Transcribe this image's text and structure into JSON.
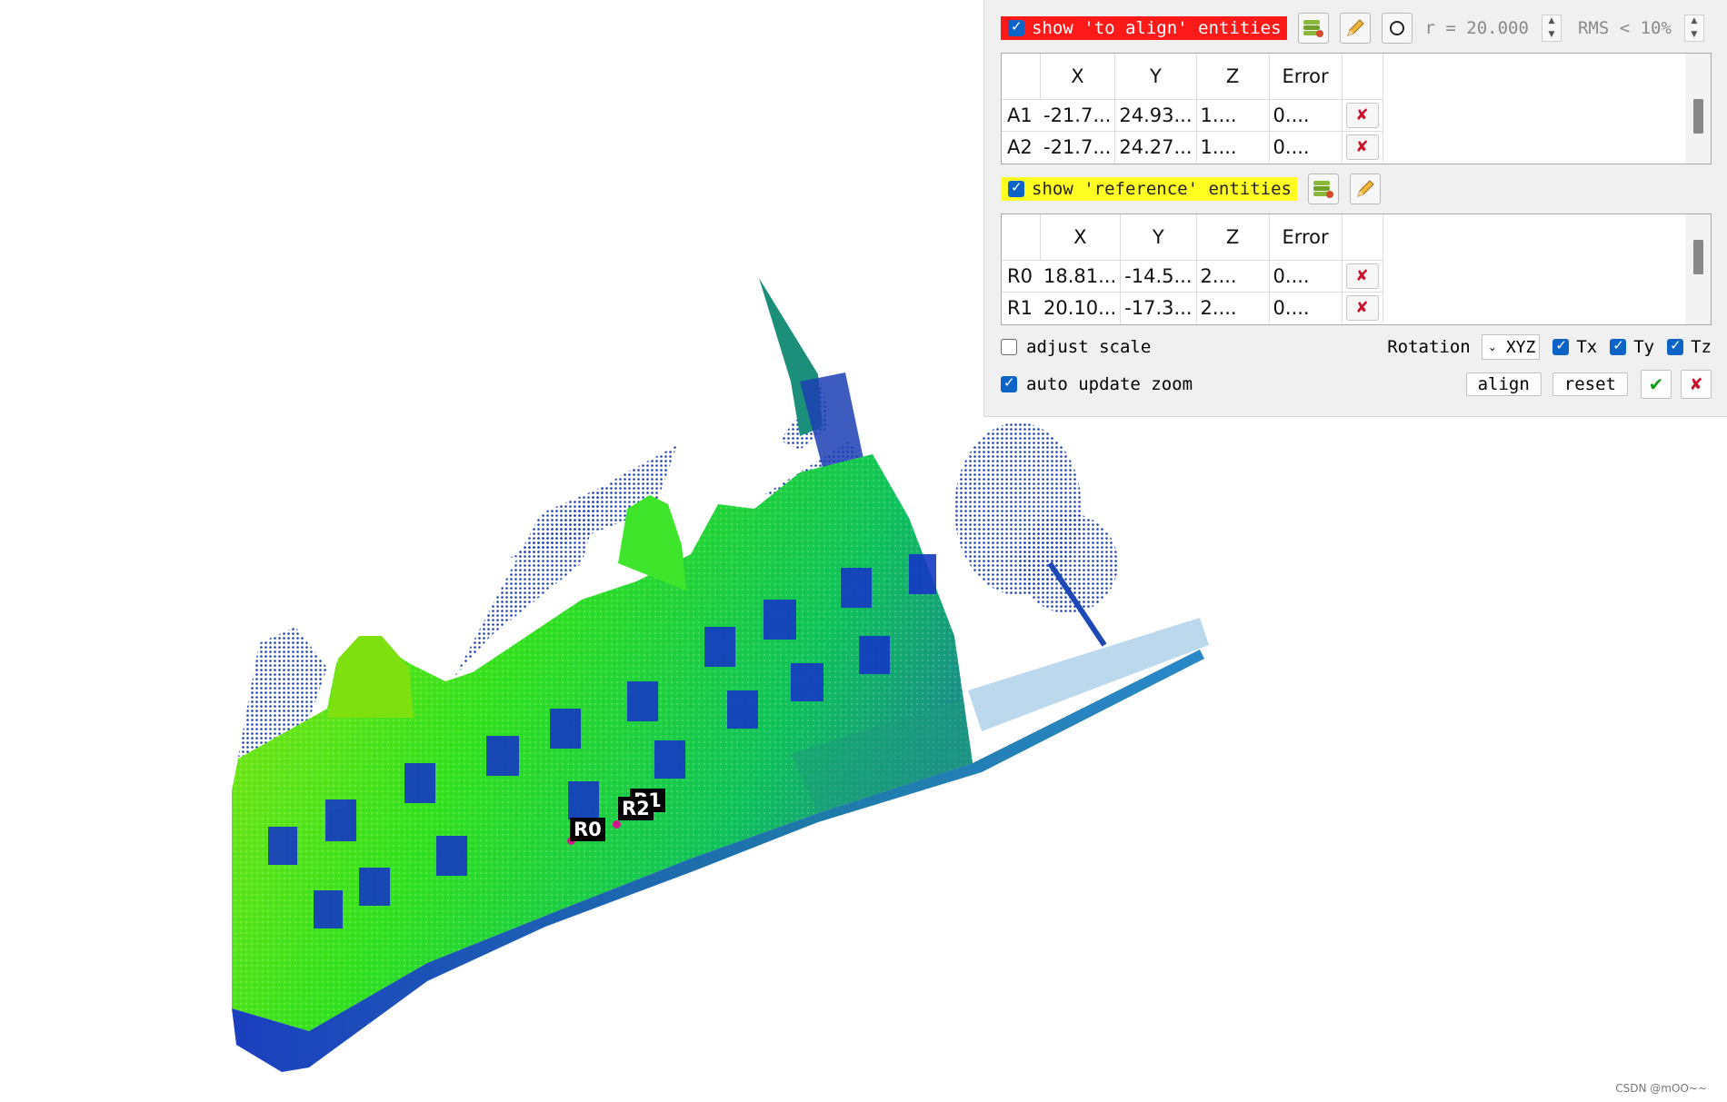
{
  "viewport": {
    "markers": [
      {
        "label": "R0"
      },
      {
        "label": "R2"
      },
      {
        "label": "R1"
      }
    ],
    "watermark": "CSDN @mOO~~"
  },
  "panel": {
    "align_section": {
      "show_label": "show 'to align' entities",
      "checked": true,
      "highlight_color": "#ff1a1a",
      "radius_label": "r = 20.000",
      "rms_label": "RMS < 10%",
      "headers": [
        "X",
        "Y",
        "Z",
        "Error"
      ],
      "rows": [
        {
          "name": "A1",
          "x": "-21.7...",
          "y": "24.93...",
          "z": "1....",
          "error": "0...."
        },
        {
          "name": "A2",
          "x": "-21.7...",
          "y": "24.27...",
          "z": "1....",
          "error": "0...."
        }
      ]
    },
    "reference_section": {
      "show_label": "show 'reference' entities",
      "checked": true,
      "highlight_color": "#ffff22",
      "headers": [
        "X",
        "Y",
        "Z",
        "Error"
      ],
      "rows": [
        {
          "name": "R0",
          "x": "18.81...",
          "y": "-14.5...",
          "z": "2....",
          "error": "0...."
        },
        {
          "name": "R1",
          "x": "20.10...",
          "y": "-17.3...",
          "z": "2....",
          "error": "0...."
        }
      ]
    },
    "options": {
      "adjust_scale_label": "adjust scale",
      "adjust_scale_checked": false,
      "auto_update_zoom_label": "auto update zoom",
      "auto_update_zoom_checked": true,
      "rotation_label": "Rotation",
      "rotation_value": "XYZ",
      "tx_label": "Tx",
      "ty_label": "Ty",
      "tz_label": "Tz",
      "align_button": "align",
      "reset_button": "reset"
    },
    "icons": {
      "delete": "delete-x-icon",
      "validate": "green-check-icon",
      "cancel": "red-x-icon",
      "add_entity": "database-add-icon",
      "edit": "pencil-icon",
      "sphere": "sphere-icon"
    }
  }
}
